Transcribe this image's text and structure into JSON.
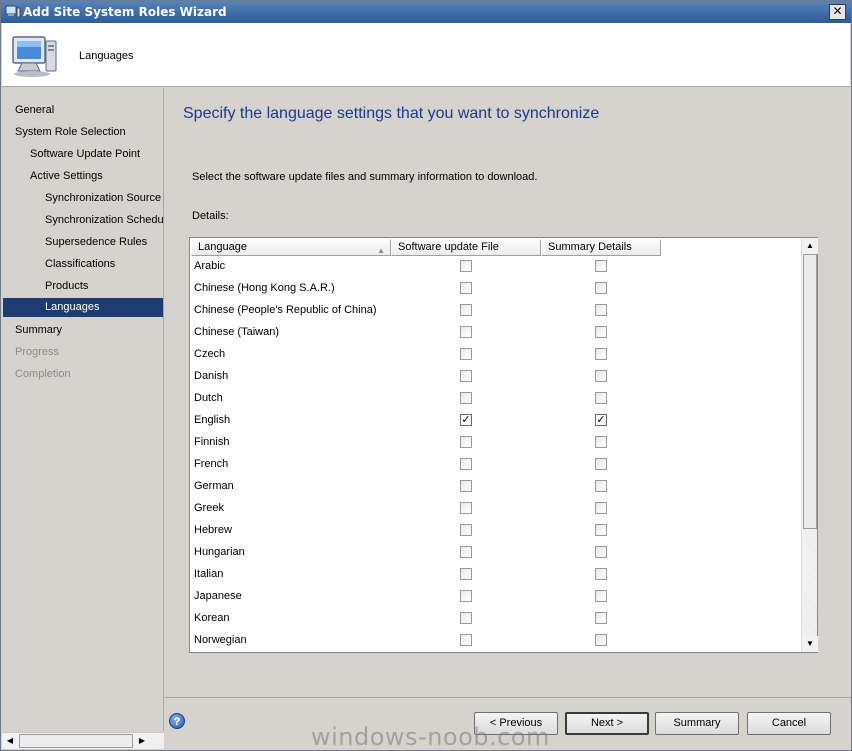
{
  "window": {
    "title": "Add Site System Roles Wizard",
    "close_glyph": "✕"
  },
  "header": {
    "page_name": "Languages"
  },
  "sidebar": {
    "items": [
      {
        "label": "General",
        "state": "normal"
      },
      {
        "label": "System Role Selection",
        "state": "normal"
      },
      {
        "label": "Software Update Point",
        "state": "normal"
      },
      {
        "label": "Active Settings",
        "state": "normal"
      },
      {
        "label": "Synchronization Source",
        "state": "normal"
      },
      {
        "label": "Synchronization Schedule",
        "state": "normal"
      },
      {
        "label": "Supersedence Rules",
        "state": "normal"
      },
      {
        "label": "Classifications",
        "state": "normal"
      },
      {
        "label": "Products",
        "state": "normal"
      },
      {
        "label": "Languages",
        "state": "selected"
      },
      {
        "label": "Summary",
        "state": "normal"
      },
      {
        "label": "Progress",
        "state": "disabled"
      },
      {
        "label": "Completion",
        "state": "disabled"
      }
    ]
  },
  "main": {
    "heading": "Specify the language settings that you want to synchronize",
    "instruction": "Select the software update files and summary information to download.",
    "details_label": "Details:",
    "columns": [
      "Language",
      "Software update File",
      "Summary Details"
    ],
    "rows": [
      {
        "language": "Arabic",
        "update_file": false,
        "summary": false
      },
      {
        "language": "Chinese (Hong Kong S.A.R.)",
        "update_file": false,
        "summary": false
      },
      {
        "language": "Chinese (People's Republic of China)",
        "update_file": false,
        "summary": false
      },
      {
        "language": "Chinese (Taiwan)",
        "update_file": false,
        "summary": false
      },
      {
        "language": "Czech",
        "update_file": false,
        "summary": false
      },
      {
        "language": "Danish",
        "update_file": false,
        "summary": false
      },
      {
        "language": "Dutch",
        "update_file": false,
        "summary": false
      },
      {
        "language": "English",
        "update_file": true,
        "summary": true
      },
      {
        "language": "Finnish",
        "update_file": false,
        "summary": false
      },
      {
        "language": "French",
        "update_file": false,
        "summary": false
      },
      {
        "language": "German",
        "update_file": false,
        "summary": false
      },
      {
        "language": "Greek",
        "update_file": false,
        "summary": false
      },
      {
        "language": "Hebrew",
        "update_file": false,
        "summary": false
      },
      {
        "language": "Hungarian",
        "update_file": false,
        "summary": false
      },
      {
        "language": "Italian",
        "update_file": false,
        "summary": false
      },
      {
        "language": "Japanese",
        "update_file": false,
        "summary": false
      },
      {
        "language": "Korean",
        "update_file": false,
        "summary": false
      },
      {
        "language": "Norwegian",
        "update_file": false,
        "summary": false
      }
    ]
  },
  "buttons": {
    "previous": "< Previous",
    "next": "Next >",
    "summary": "Summary",
    "cancel": "Cancel"
  },
  "help_glyph": "?",
  "check_glyph": "✓",
  "watermark": "windows-noob.com",
  "colors": {
    "selected_bg": "#1f3c72",
    "heading": "#1a3a8c",
    "titlebar": "#3a6aa8"
  }
}
